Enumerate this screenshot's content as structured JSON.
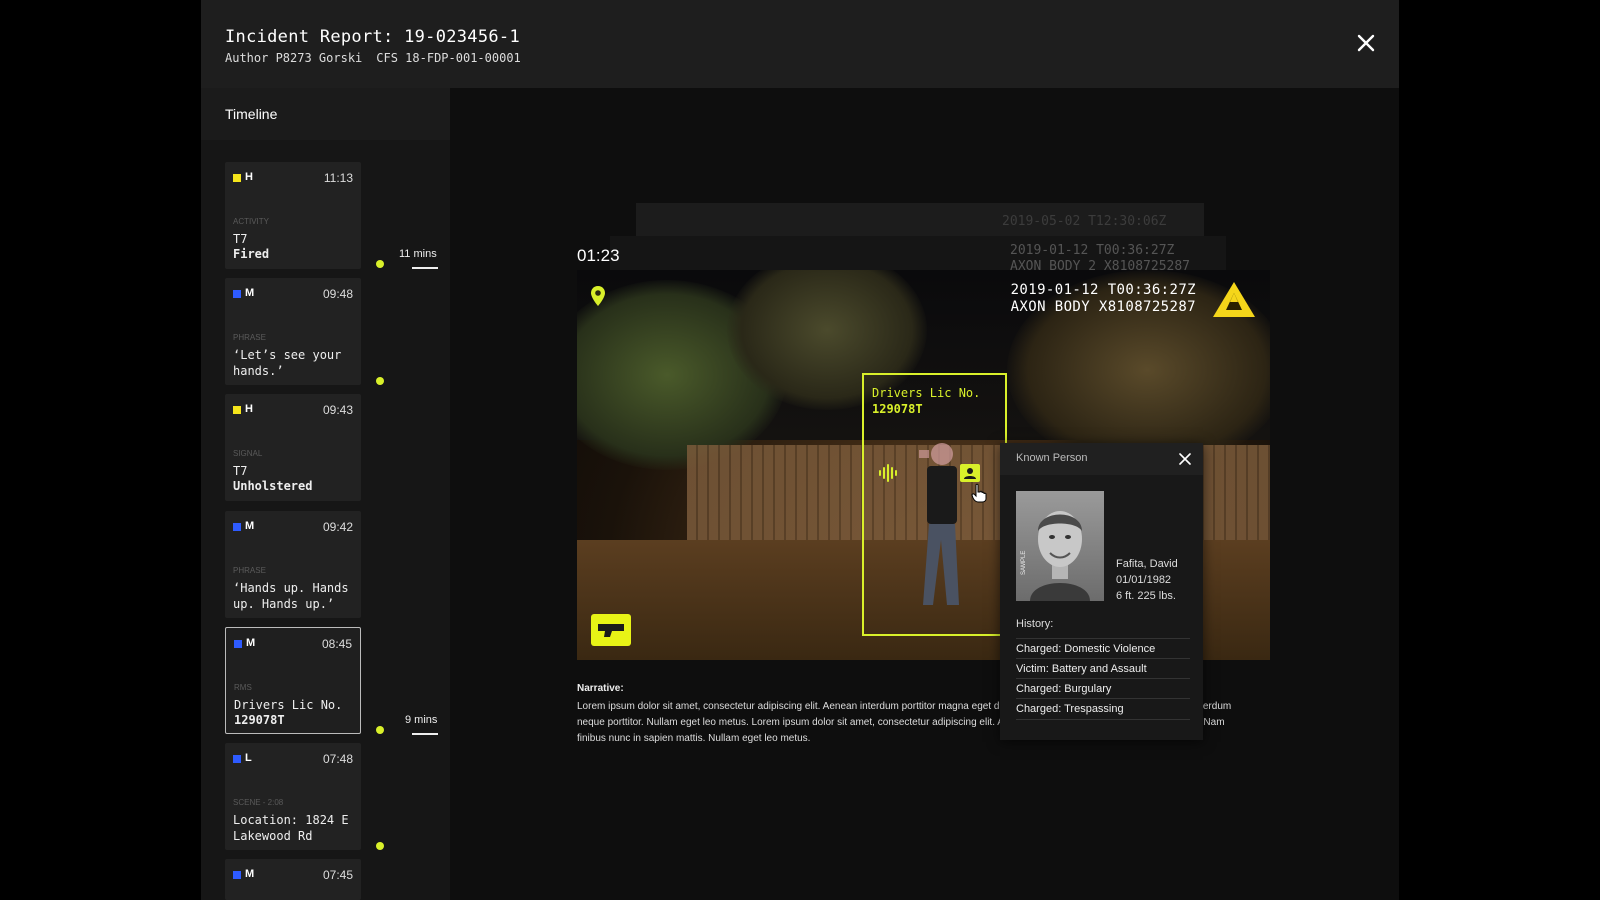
{
  "header": {
    "title": "Incident Report: 19-023456-1",
    "author": "Author P8273 Gorski",
    "cfs": "CFS 18-FDP-001-00001"
  },
  "colors": {
    "accent": "#d9f02a",
    "high": "#f5e51b",
    "medium": "#2e5bff",
    "low": "#2e5bff"
  },
  "timeline": {
    "title": "Timeline",
    "items": [
      {
        "level": "H",
        "time": "11:13",
        "type": "ACTIVITY",
        "line1": "T7",
        "line2": "Fired",
        "color": "#f5e51b"
      },
      {
        "level": "M",
        "time": "09:48",
        "type": "PHRASE",
        "text": "‘Let’s see your hands.’",
        "color": "#2e5bff"
      },
      {
        "level": "H",
        "time": "09:43",
        "type": "SIGNAL",
        "line1": "T7",
        "line2": "Unholstered",
        "color": "#f5e51b"
      },
      {
        "level": "M",
        "time": "09:42",
        "type": "PHRASE",
        "text": "‘Hands up. Hands up. Hands up.’",
        "color": "#2e5bff"
      },
      {
        "level": "M",
        "time": "08:45",
        "type": "RMS",
        "line1": "Drivers Lic No.",
        "line2": "129078T",
        "color": "#2e5bff",
        "selected": true
      },
      {
        "level": "L",
        "time": "07:48",
        "type": "SCENE - 2:08",
        "text": "Location: 1824 E Lakewood Rd",
        "color": "#2e5bff"
      },
      {
        "level": "M",
        "time": "07:45",
        "color": "#2e5bff"
      }
    ],
    "gaps": [
      {
        "label": "11 mins"
      },
      {
        "label": "9 mins"
      }
    ]
  },
  "stack": {
    "back": "2019-05-02 T12:30:06Z",
    "mid_line1": "2019-01-12 T00:36:27Z",
    "mid_line2": "AXON BODY 2 X8108725287"
  },
  "video": {
    "clock": "01:23",
    "timestamp": "2019-01-12 T00:36:27Z",
    "device": "AXON BODY X8108725287",
    "detection_label": "Drivers Lic No.",
    "detection_value": "129078T"
  },
  "narrative": {
    "title": "Narrative:",
    "text": "Lorem ipsum dolor sit amet, consectetur adipiscing elit. Aenean interdum porttitor magna eget dictum. Nam finibus nunc in sapien mattis, a interdum neque porttitor. Nullam eget leo metus. Lorem ipsum dolor sit amet, consectetur adipiscing elit. Aenean interdum porttitor magna eget dictum. Nam finibus nunc in sapien mattis. Nullam eget leo metus."
  },
  "popup": {
    "title": "Known Person",
    "name": "Fafita, David",
    "dob": "01/01/1982",
    "build": "6 ft. 225 lbs.",
    "sample": "SAMPLE",
    "history_label": "History:",
    "history": [
      "Charged: Domestic Violence",
      "Victim: Battery and Assault",
      "Charged: Burgulary",
      "Charged: Trespassing"
    ]
  }
}
